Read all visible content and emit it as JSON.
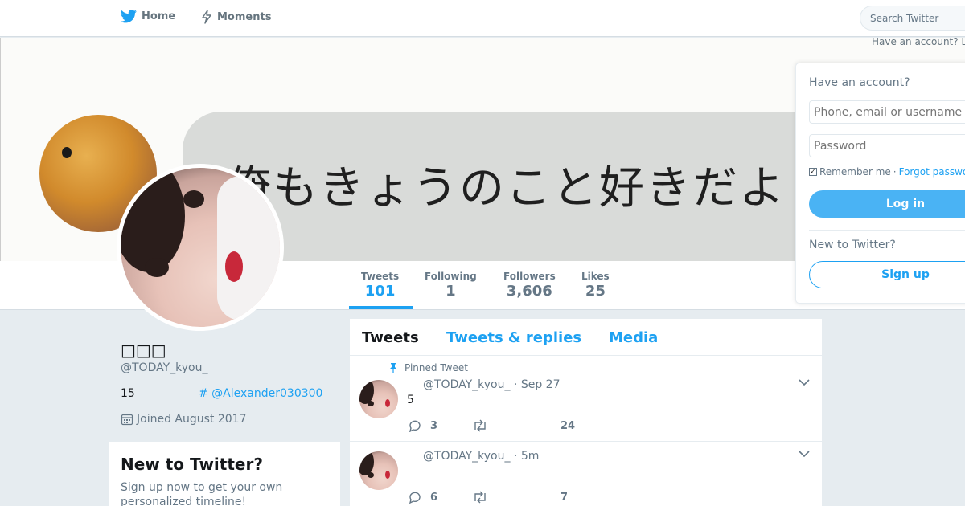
{
  "nav": {
    "home_label": "Home",
    "moments_label": "Moments",
    "search_placeholder": "Search Twitter",
    "have_account_top": "Have an account? Log in"
  },
  "banner": {
    "text": "俺もきょうのこと好きだよ"
  },
  "stats": [
    {
      "label": "Tweets",
      "value": "101"
    },
    {
      "label": "Following",
      "value": "1"
    },
    {
      "label": "Followers",
      "value": "3,606"
    },
    {
      "label": "Likes",
      "value": "25"
    }
  ],
  "profile": {
    "name": "□□□",
    "handle": "@TODAY_kyou_",
    "bio": "15",
    "link": "# @Alexander030300",
    "joined": "Joined August 2017"
  },
  "signup_box": {
    "title": "New to Twitter?",
    "text": "Sign up now to get your own personalized timeline!"
  },
  "tabs": [
    "Tweets",
    "Tweets & replies",
    "Media"
  ],
  "tweets": [
    {
      "pinned_label": "Pinned Tweet",
      "header": "@TODAY_kyou_ · Sep 27",
      "text": "5",
      "replies": "3",
      "likes": "24"
    },
    {
      "header": "@TODAY_kyou_ · 5m",
      "replies": "6",
      "likes": "7"
    }
  ],
  "login": {
    "title": "Have an account?",
    "username_placeholder": "Phone, email or username",
    "password_placeholder": "Password",
    "remember": "Remember me",
    "forgot": "Forgot password?",
    "login_button": "Log in",
    "new_title": "New to Twitter?",
    "signup_button": "Sign up"
  },
  "colors": {
    "accent": "#1da1f2",
    "background": "#e6ecf0"
  }
}
